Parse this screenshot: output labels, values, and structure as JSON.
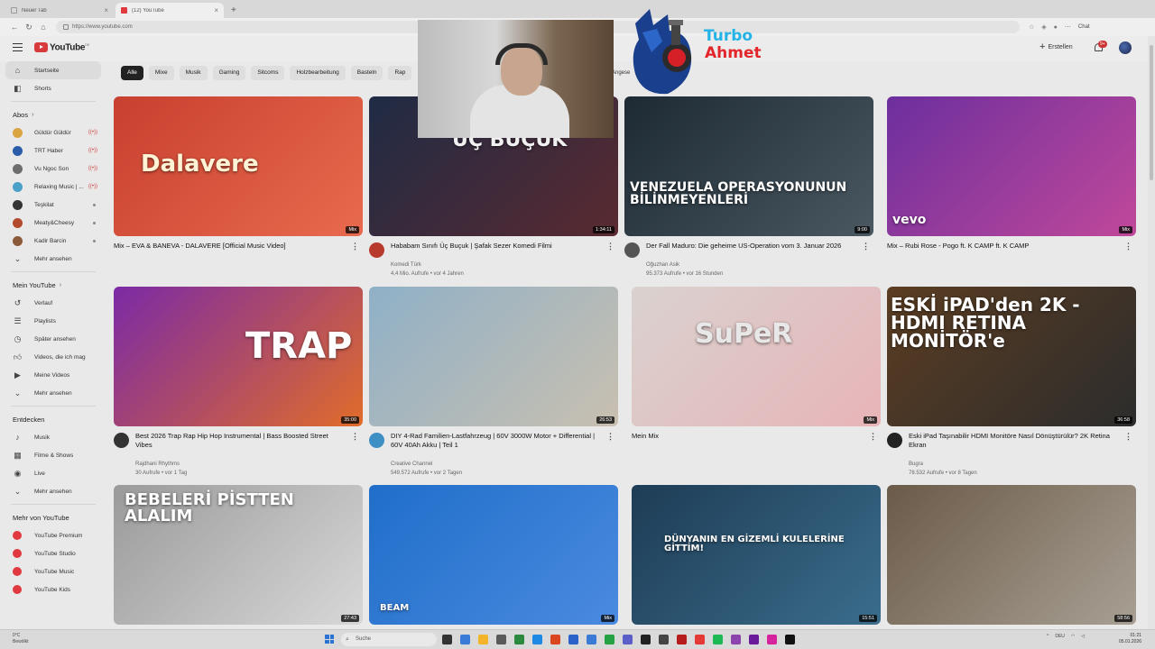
{
  "browser": {
    "tabs": [
      {
        "label": "Neuer Tab",
        "active": false
      },
      {
        "label": "(12) YouTube",
        "active": true
      }
    ],
    "url": "https://www.youtube.com",
    "chat_label": "Chat"
  },
  "header": {
    "logo_text": "YouTube",
    "logo_suffix": "DE",
    "create_label": "Erstellen",
    "notif_count": "9+"
  },
  "sidebar": {
    "main": [
      {
        "label": "Startseite",
        "icon": "home-icon"
      },
      {
        "label": "Shorts",
        "icon": "shorts-icon"
      }
    ],
    "subs_title": "Abos",
    "subs": [
      {
        "label": "Güldür Güldür",
        "color": "#d9a441",
        "live": true
      },
      {
        "label": "TRT Haber",
        "color": "#2a5caa",
        "live": true
      },
      {
        "label": "Vu Ngoc Son",
        "color": "#6d6d6d",
        "live": true
      },
      {
        "label": "Relaxing Music | ...",
        "color": "#4aa0c9",
        "live": true
      },
      {
        "label": "Teşkilat",
        "color": "#333333",
        "dot": true
      },
      {
        "label": "Meaty&Cheesy",
        "color": "#b24b2e",
        "dot": true
      },
      {
        "label": "Kadir Barcin",
        "color": "#8a5a3a",
        "dot": true
      }
    ],
    "subs_more": "Mehr ansehen",
    "you_title": "Mein YouTube",
    "you": [
      {
        "label": "Verlauf",
        "icon": "history-icon"
      },
      {
        "label": "Playlists",
        "icon": "playlists-icon"
      },
      {
        "label": "Später ansehen",
        "icon": "watch-later-icon"
      },
      {
        "label": "Videos, die ich mag",
        "icon": "like-icon"
      },
      {
        "label": "Meine Videos",
        "icon": "my-videos-icon"
      }
    ],
    "you_more": "Mehr ansehen",
    "explore_title": "Entdecken",
    "explore": [
      {
        "label": "Musik",
        "icon": "music-icon"
      },
      {
        "label": "Filme & Shows",
        "icon": "film-icon"
      },
      {
        "label": "Live",
        "icon": "live-icon"
      }
    ],
    "explore_more": "Mehr ansehen",
    "more_title": "Mehr von YouTube",
    "more": [
      {
        "label": "YouTube Premium",
        "color": "#e0393e"
      },
      {
        "label": "YouTube Studio",
        "color": "#e0393e"
      },
      {
        "label": "YouTube Music",
        "color": "#e0393e"
      },
      {
        "label": "YouTube Kids",
        "color": "#e0393e"
      }
    ]
  },
  "chips": [
    "Alle",
    "Mixe",
    "Musik",
    "Gaming",
    "Sitcoms",
    "Holzbearbeitung",
    "Basteln",
    "Rap"
  ],
  "chip_partial": "Angese",
  "videos": [
    {
      "title": "Mix – EVA & BANEVA - DALAVERE [Official Music Video]",
      "channel": "",
      "stats": "",
      "badge": "Mix",
      "mix": true,
      "thumb_text": "Dalavere",
      "bg": "#c8402f",
      "bg2": "#e86a4e",
      "avatar": ""
    },
    {
      "title": "Hababam Sınıfı Üç Buçuk | Şafak Sezer Komedi Filmi",
      "channel": "Komedi Türk",
      "stats": "4,4 Mio. Aufrufe • vor 4 Jahren",
      "badge": "1:34:11",
      "mix": false,
      "thumb_text": "ÜÇ BUÇUK",
      "bg": "#1f2b45",
      "bg2": "#5a2a30",
      "avatar": "#b83a2c"
    },
    {
      "title": "Der Fall Maduro: Die geheime US-Operation vom 3. Januar 2026",
      "channel": "Oğuzhan Asik",
      "stats": "95.373 Aufrufe • vor 16 Stunden",
      "badge": "9:00",
      "mix": false,
      "thumb_text": "VENEZUELA OPERASYONUNUN BİLİNMEYENLERİ",
      "bg": "#1d2a33",
      "bg2": "#4a5862",
      "avatar": "#555555"
    },
    {
      "title": "Mix – Rubi Rose - Pogo ft. K CAMP ft. K CAMP",
      "channel": "",
      "stats": "",
      "badge": "Mix",
      "mix": true,
      "thumb_text": "vevo",
      "bg": "#6c2f9e",
      "bg2": "#c0489a",
      "avatar": ""
    },
    {
      "title": "Best 2026 Trap Rap Hip Hop Instrumental | Bass Boosted Street Vibes",
      "channel": "Rajdhani Rhythms",
      "stats": "30 Aufrufe • vor 1 Tag",
      "badge": "35:00",
      "mix": false,
      "thumb_text": "TRAP",
      "bg": "#7b2aa6",
      "bg2": "#e06c2a",
      "avatar": "#333333"
    },
    {
      "title": "DIY 4-Rad Familien-Lastfahrzeug | 60V 3000W Motor + Differential | 60V 40Ah Akku | Teil 1",
      "channel": "Creative Channel",
      "stats": "549.572 Aufrufe • vor 2 Tagen",
      "badge": "26:53",
      "mix": false,
      "thumb_text": "",
      "bg": "#8fb0c7",
      "bg2": "#c9c0b0",
      "avatar": "#3d8fc4"
    },
    {
      "title": "Mein Mix",
      "channel": "",
      "stats": "",
      "badge": "Mix",
      "mix": true,
      "thumb_text": "SuPeR",
      "bg": "#d9d2cf",
      "bg2": "#e8b4b8",
      "avatar": ""
    },
    {
      "title": "Eski iPad Taşınabilir HDMI Monitöre Nasıl Dönüştürülür? 2K Retina Ekran",
      "channel": "Bugra",
      "stats": "78.532 Aufrufe • vor 8 Tagen",
      "badge": "36:58",
      "mix": false,
      "thumb_text": "ESKİ iPAD'den 2K - HDMI RETINA MONİTÖR'e",
      "bg": "#5b3d22",
      "bg2": "#2c2c2c",
      "avatar": "#222222"
    },
    {
      "title": "",
      "channel": "",
      "stats": "",
      "badge": "27:43",
      "mix": false,
      "thumb_text": "BEBELERİ PİSTTEN ALALIM",
      "bg": "#9a9a9a",
      "bg2": "#d8d8d8",
      "avatar": ""
    },
    {
      "title": "",
      "channel": "",
      "stats": "",
      "badge": "Mix",
      "mix": true,
      "thumb_text": "BEAM",
      "bg": "#1f6ec9",
      "bg2": "#4b8ae0",
      "avatar": ""
    },
    {
      "title": "",
      "channel": "",
      "stats": "",
      "badge": "15:51",
      "mix": false,
      "thumb_text": "DÜNYANIN EN GİZEMLİ KULELERİNE GİTTİM!",
      "bg": "#1e3c55",
      "bg2": "#3a6d8c",
      "avatar": ""
    },
    {
      "title": "",
      "channel": "",
      "stats": "",
      "badge": "58:56",
      "mix": false,
      "thumb_text": "",
      "bg": "#6b5a48",
      "bg2": "#a8a094",
      "avatar": ""
    }
  ],
  "stream_logo": {
    "line1": "Turbo",
    "line2": "Ahmet"
  },
  "taskbar": {
    "weather_temp": "0°C",
    "weather_desc": "Bewölkt",
    "search_placeholder": "Suche",
    "lang": "DEU",
    "time": "01:21",
    "date": "05.01.2026"
  }
}
